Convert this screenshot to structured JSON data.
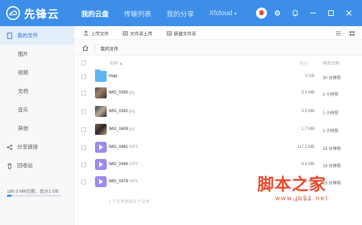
{
  "app": {
    "logo_text": "先锋云"
  },
  "nav": {
    "items": [
      {
        "label": "我的云盘",
        "active": true
      },
      {
        "label": "传输列表",
        "active": false
      },
      {
        "label": "我的分享",
        "active": false
      },
      {
        "label": "Xfcloud",
        "active": false
      }
    ],
    "account_caret": "▾"
  },
  "top_icons": [
    "avatar",
    "gear-icon",
    "bell-icon",
    "minimize-icon",
    "maximize-icon",
    "close-icon"
  ],
  "sidebar": {
    "items": [
      {
        "label": "我的文件",
        "icon": "file-icon",
        "active": true
      },
      {
        "label": "图片",
        "active": false
      },
      {
        "label": "视频",
        "active": false
      },
      {
        "label": "文档",
        "active": false
      },
      {
        "label": "音乐",
        "active": false
      },
      {
        "label": "其他",
        "active": false
      },
      {
        "label": "分享链接",
        "icon": "share-icon",
        "active": false
      },
      {
        "label": "回收站",
        "icon": "trash-icon",
        "active": false
      }
    ],
    "storage_text": "189.3 MB已用，总计2 GB",
    "storage_used_fraction": 0.0925
  },
  "toolbar": {
    "upload_file": "上传文件",
    "upload_folder": "文件夹上传",
    "new_folder": "新建文件夹"
  },
  "breadcrumb": {
    "current": "我的文件"
  },
  "list": {
    "header_name": "名称",
    "header_sort": "▲",
    "header_size": "大小",
    "header_time": "修改日期",
    "rows": [
      {
        "name": "Hapi",
        "ext": "",
        "type": "folder",
        "size": "0 KB",
        "time": "30 分钟前"
      },
      {
        "name": "IMG_0390",
        "ext": ".jpg",
        "type": "photo1",
        "size": "3.3 MB",
        "time": "1 小时前"
      },
      {
        "name": "IMG_0392",
        "ext": ".jpg",
        "type": "photo2",
        "size": "3.5 MB",
        "time": "1 小时前"
      },
      {
        "name": "IMG_0409",
        "ext": ".jpg",
        "type": "photo3",
        "size": "1.7 MB",
        "time": "1 小时前"
      },
      {
        "name": "IMG_0461",
        "ext": ".MP4",
        "type": "video",
        "size": "117.2 MB",
        "time": "15 分钟前"
      },
      {
        "name": "IMG_0464",
        "ext": ".MP4",
        "type": "video",
        "size": "8.4 MB",
        "time": "15 分钟前"
      },
      {
        "name": "IMG_0478",
        "ext": ".MP4",
        "type": "video",
        "size": "55 MB",
        "time": "15 分钟前"
      }
    ],
    "summary": "1 个文件夹和 6 个文件",
    "total_size": "189.3 MB"
  },
  "watermark": {
    "cn": "脚本之家",
    "url": "www.jb51.net"
  },
  "colors": {
    "brand": "#3c8ee8",
    "watermark": "#e84a2a",
    "video_thumb": "#9b8af2",
    "folder": "#61b4f1"
  }
}
